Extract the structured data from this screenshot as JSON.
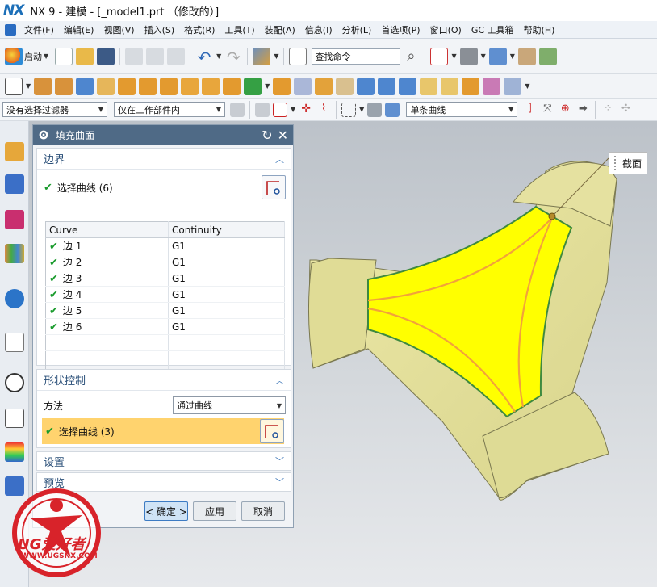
{
  "window": {
    "logo": "NX",
    "title": "NX 9 - 建模 - [_model1.prt （修改的）]"
  },
  "menu": [
    "文件(F)",
    "编辑(E)",
    "视图(V)",
    "插入(S)",
    "格式(R)",
    "工具(T)",
    "装配(A)",
    "信息(I)",
    "分析(L)",
    "首选项(P)",
    "窗口(O)",
    "GC 工具箱",
    "帮助(H)"
  ],
  "toolbar": {
    "start_label": "启动",
    "search_value": "查找命令"
  },
  "filter_bar": {
    "selection_filter": "没有选择过滤器",
    "scope": "仅在工作部件内",
    "curve_rule": "单条曲线"
  },
  "dialog": {
    "title": "填充曲面",
    "boundary": {
      "header": "边界",
      "select_label": "选择曲线 (6)",
      "columns": [
        "Curve",
        "Continuity"
      ],
      "rows": [
        {
          "curve": "边 1",
          "continuity": "G1"
        },
        {
          "curve": "边 2",
          "continuity": "G1"
        },
        {
          "curve": "边 3",
          "continuity": "G1"
        },
        {
          "curve": "边 4",
          "continuity": "G1"
        },
        {
          "curve": "边 5",
          "continuity": "G1"
        },
        {
          "curve": "边 6",
          "continuity": "G1"
        }
      ]
    },
    "shape": {
      "header": "形状控制",
      "method_label": "方法",
      "method_value": "通过曲线",
      "select_label": "选择曲线 (3)"
    },
    "settings_header": "设置",
    "preview_header": "预览",
    "ok": "< 确定 >",
    "apply": "应用",
    "cancel": "取消"
  },
  "viewport": {
    "section_label": "截面"
  },
  "watermark": {
    "brand": "UG爱好者",
    "url": "WWW.UGSNX.COM"
  },
  "colors": {
    "accent": "#4f6a86",
    "highlight": "#ffd36e",
    "fill_surface": "#ffff00",
    "body": "#e8e5a2"
  }
}
